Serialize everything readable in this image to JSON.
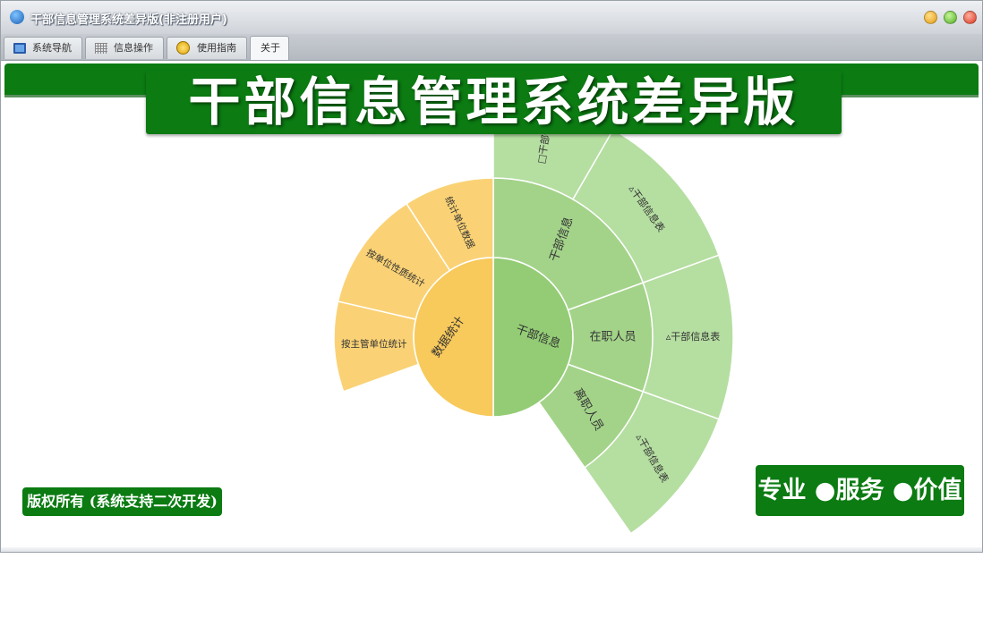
{
  "window": {
    "title": "干部信息管理系统差异版(非注册用户)"
  },
  "tabs": [
    {
      "label": "系统导航",
      "icon": "monitor-icon",
      "active": false
    },
    {
      "label": "信息操作",
      "icon": "grid-icon",
      "active": false
    },
    {
      "label": "使用指南",
      "icon": "guide-icon",
      "active": false
    },
    {
      "label": "关于",
      "icon": "",
      "active": true
    }
  ],
  "banner": {
    "text": "干部信息管理系统差异版"
  },
  "chart_data": {
    "type": "sunburst",
    "rings": [
      {
        "level": 1,
        "segments": [
          {
            "label": "干部信息",
            "color": "#93cc75"
          },
          {
            "label": "数据统计",
            "color": "#f8c95b"
          }
        ]
      },
      {
        "level": 2,
        "segments": [
          {
            "label": "干部信息",
            "parent": "干部信息",
            "color": "#a3d389"
          },
          {
            "label": "在职人员",
            "parent": "干部信息",
            "color": "#a3d389"
          },
          {
            "label": "离职人员",
            "parent": "干部信息",
            "color": "#a3d389"
          },
          {
            "label": "按主管单位统计",
            "parent": "数据统计",
            "color": "#fad275"
          },
          {
            "label": "按单位性质统计",
            "parent": "数据统计",
            "color": "#fad275"
          },
          {
            "label": "统计单位数据",
            "parent": "数据统计",
            "color": "#fad275"
          }
        ]
      },
      {
        "level": 3,
        "segments": [
          {
            "label": "□干部信",
            "parent": "干部信息",
            "color": "#b5dea1"
          },
          {
            "label": "▵干部信息表",
            "parent": "干部信息",
            "color": "#b5dea1"
          },
          {
            "label": "▵干部信息表",
            "parent": "在职人员",
            "color": "#b5dea1"
          },
          {
            "label": "▵干部信息表",
            "parent": "离职人员",
            "color": "#b5dea1"
          }
        ]
      }
    ]
  },
  "footer": {
    "copyright": "版权所有 (系统支持二次开发)",
    "slogan": "专业 ●服务 ●价值"
  },
  "colors": {
    "accent_green": "#0b7b12",
    "inner_green": "#93cc75",
    "inner_orange": "#f8c95b"
  }
}
